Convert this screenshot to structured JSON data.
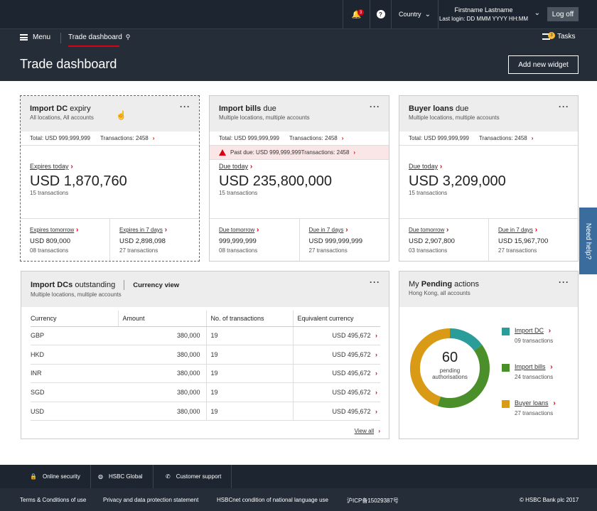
{
  "topbar": {
    "notifications_count": "3",
    "help_icon": "?",
    "country_label": "Country",
    "user_name": "Firstname Lastname",
    "last_login": "Last login: DD MMM YYYY HH:MM",
    "logoff_label": "Log off"
  },
  "nav": {
    "menu_label": "Menu",
    "tab_label": "Trade dashboard",
    "tasks_count": "3",
    "tasks_label": "Tasks"
  },
  "page": {
    "title": "Trade dashboard",
    "add_widget_label": "Add new widget"
  },
  "card1": {
    "title_bold": "Import DC",
    "title_rest": " expiry",
    "sub": "All locations, All accounts",
    "total_label": "Total:",
    "total_value": "USD 999,999,999",
    "tx_label": "Transactions:",
    "tx_value": "2458",
    "main_link": "Expires today",
    "main_value": "USD 1,870,760",
    "main_sub": "15 transactions",
    "left_link": "Expires tomorrow",
    "left_value": "USD 809,000",
    "left_sub": "08 transactions",
    "right_link": "Expires in 7 days",
    "right_value": "USD 2,898,098",
    "right_sub": "27 transactions"
  },
  "card2": {
    "title_bold": "Import bills",
    "title_rest": " due",
    "sub": "Multiple locations, multiple accounts",
    "total_label": "Total:",
    "total_value": "USD 999,999,999",
    "tx_label": "Transactions:",
    "tx_value": "2458",
    "pastdue_label": "Past due:",
    "pastdue_value": "USD 999,999,999",
    "pastdue_tx_label": "Transactions:",
    "pastdue_tx_value": "2458",
    "main_link": "Due today",
    "main_value": "USD 235,800,000",
    "main_sub": "15 transactions",
    "left_link": "Due tomorrow",
    "left_value": "999,999,999",
    "left_sub": "08 transactions",
    "right_link": "Due in 7 days",
    "right_value": "USD 999,999,999",
    "right_sub": "27 transactions"
  },
  "card3": {
    "title_bold": "Buyer loans",
    "title_rest": " due",
    "sub": "Multiple locations, multiple accounts",
    "total_label": "Total:",
    "total_value": "USD 999,999,999",
    "tx_label": "Transactions:",
    "tx_value": "2458",
    "main_link": "Due today",
    "main_value": "USD 3,209,000",
    "main_sub": "15 transactions",
    "left_link": "Due tomorrow",
    "left_value": "USD 2,907,800",
    "left_sub": "03 transactions",
    "right_link": "Due in 7 days",
    "right_value": "USD 15,967,700",
    "right_sub": "27 transactions"
  },
  "outstanding": {
    "title_bold": "Import DCs",
    "title_rest": " outstanding",
    "view_label": "Currency view",
    "sub": "Multiple locations, multiple accounts",
    "columns": [
      "Currency",
      "Amount",
      "No. of transactions",
      "Equivalent currency"
    ],
    "rows": [
      {
        "currency": "GBP",
        "amount": "380,000",
        "count": "19",
        "equiv": "USD 495,672"
      },
      {
        "currency": "HKD",
        "amount": "380,000",
        "count": "19",
        "equiv": "USD 495,672"
      },
      {
        "currency": "INR",
        "amount": "380,000",
        "count": "19",
        "equiv": "USD 495,672"
      },
      {
        "currency": "SGD",
        "amount": "380,000",
        "count": "19",
        "equiv": "USD 495,672"
      },
      {
        "currency": "USD",
        "amount": "380,000",
        "count": "19",
        "equiv": "USD 495,672"
      }
    ],
    "view_all": "View all"
  },
  "pending": {
    "title_pre": "My ",
    "title_bold": "Pending",
    "title_rest": " actions",
    "sub": "Hong Kong, all accounts",
    "center_value": "60",
    "center_label_1": "pending",
    "center_label_2": "authorisations",
    "items": [
      {
        "label": "Import DC",
        "sub": "09 transactions",
        "color": "#2a9d9a",
        "value": 9
      },
      {
        "label": "Import bills",
        "sub": "24 transactions",
        "color": "#4a8f2a",
        "value": 24
      },
      {
        "label": "Buyer loans",
        "sub": "27 transactions",
        "color": "#d99a16",
        "value": 27
      }
    ]
  },
  "needhelp": "Need help?",
  "footer": {
    "online_security": "Online security",
    "hsbc_global": "HSBC Global",
    "customer_support": "Customer support",
    "terms": "Terms & Conditions of use",
    "privacy": "Privacy and data protection statement",
    "language": "HSBCnet condition of national language use",
    "icp": "沪ICP备15029387号",
    "copyright": "© HSBC Bank plc 2017"
  }
}
